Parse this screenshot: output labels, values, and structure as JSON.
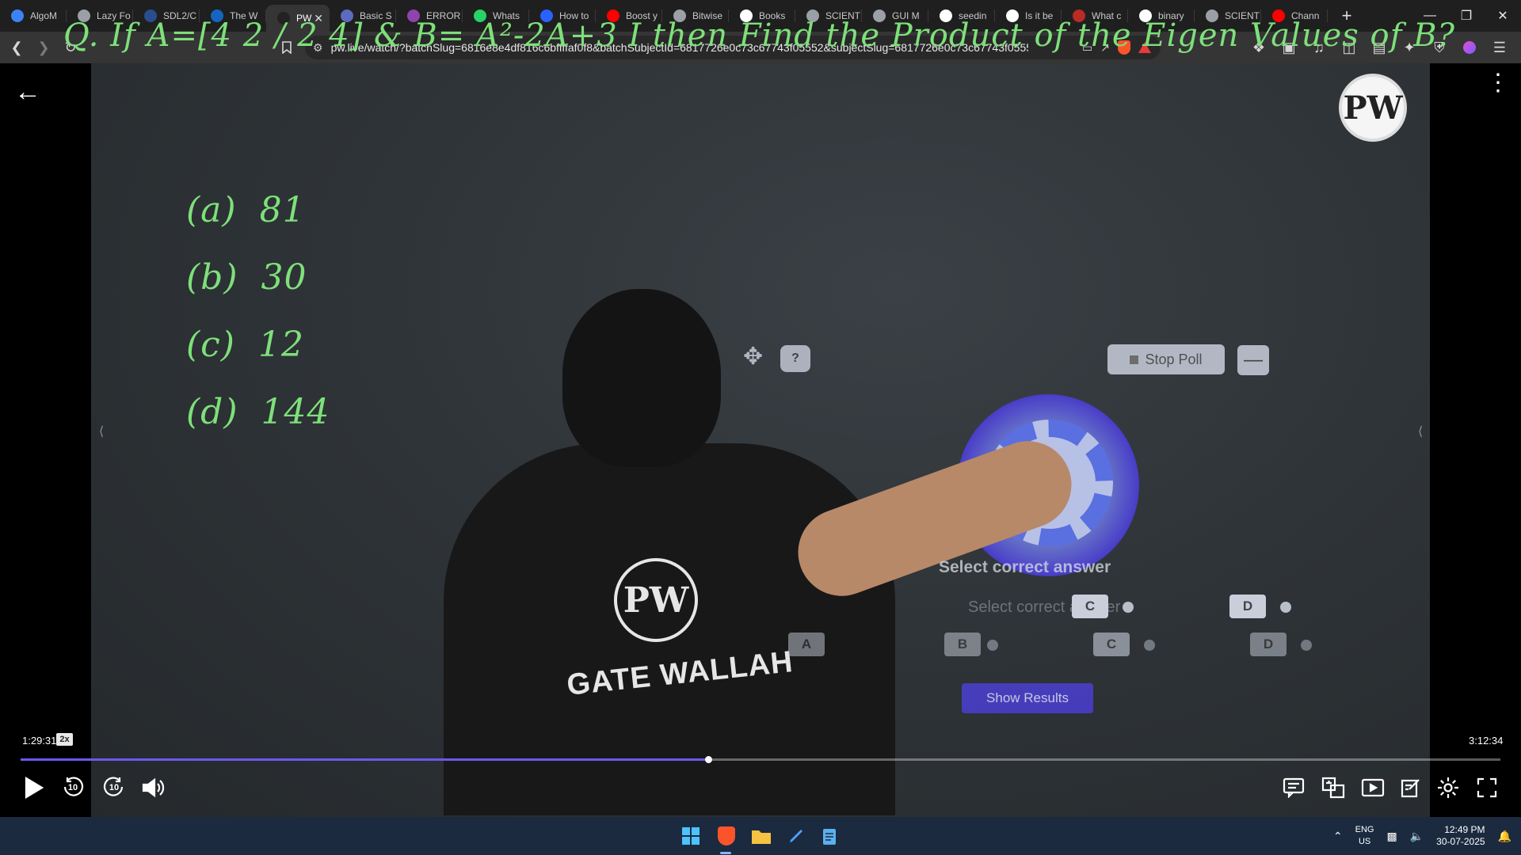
{
  "browser": {
    "tabs": [
      {
        "label": "AlgoM",
        "icon": "globe-icon",
        "color": "#3b82f6",
        "active": false
      },
      {
        "label": "Lazy Fo",
        "icon": "globe-icon",
        "color": "#9aa0a6",
        "active": false
      },
      {
        "label": "SDL2/C",
        "icon": "sdl-icon",
        "color": "#2a4d8f",
        "active": false
      },
      {
        "label": "The W",
        "icon": "ws-icon",
        "color": "#1565c0",
        "active": false
      },
      {
        "label": "PW",
        "icon": "pw-icon",
        "color": "#222222",
        "active": true
      },
      {
        "label": "Basic S",
        "icon": "page-icon",
        "color": "#5c6bc0",
        "active": false
      },
      {
        "label": "ERROR",
        "icon": "error-icon",
        "color": "#8e44ad",
        "active": false
      },
      {
        "label": "Whats",
        "icon": "whatsapp-icon",
        "color": "#25d366",
        "active": false
      },
      {
        "label": "How to",
        "icon": "page-icon",
        "color": "#2962ff",
        "active": false
      },
      {
        "label": "Boost y",
        "icon": "youtube-icon",
        "color": "#ff0000",
        "active": false
      },
      {
        "label": "Bitwise",
        "icon": "page-icon",
        "color": "#9aa0a6",
        "active": false
      },
      {
        "label": "Books",
        "icon": "google-icon",
        "color": "#ffffff",
        "active": false
      },
      {
        "label": "SCIENT",
        "icon": "globe-icon",
        "color": "#9aa0a6",
        "active": false
      },
      {
        "label": "GUI M",
        "icon": "openai-icon",
        "color": "#9aa0a6",
        "active": false
      },
      {
        "label": "seedin",
        "icon": "google-icon",
        "color": "#ffffff",
        "active": false
      },
      {
        "label": "Is it be",
        "icon": "google-icon",
        "color": "#ffffff",
        "active": false
      },
      {
        "label": "What c",
        "icon": "quora-icon",
        "color": "#b92b27",
        "active": false
      },
      {
        "label": "binary",
        "icon": "google-icon",
        "color": "#ffffff",
        "active": false
      },
      {
        "label": "SCIENT",
        "icon": "globe-icon",
        "color": "#9aa0a6",
        "active": false
      },
      {
        "label": "Chann",
        "icon": "youtube-icon",
        "color": "#ff0000",
        "active": false
      }
    ],
    "url": "pw.live/watch/?batchSlug=6816e8e4df816c6bffffaf0f8&batchSubjectId=6817726e0c73c67743f05552&subjectSlug=6817726e0c73c67743f05552..."
  },
  "video": {
    "board_question": "Q. If A=[4 2 / 2 4] & B= A²-2A+3 I then Find the Product of the Eigen Values of B?",
    "options": [
      {
        "label": "(a)",
        "value": "81"
      },
      {
        "label": "(b)",
        "value": "30"
      },
      {
        "label": "(c)",
        "value": "12"
      },
      {
        "label": "(d)",
        "value": "144"
      }
    ],
    "brand_logo": "PW",
    "shirt_text": "GATE WALLAH",
    "poll": {
      "stop_label": "Stop Poll",
      "minimize_label": "—",
      "help_label": "?",
      "prompt": "Select correct answer",
      "prompt_ghost": "Select correct answer",
      "options_row1": [
        "C",
        "D"
      ],
      "options_row2": [
        "A",
        "B",
        "C",
        "D"
      ],
      "show_results_label": "Show Results"
    },
    "time_current": "1:29:31",
    "speed": "2x",
    "time_total": "3:12:34",
    "progress_fraction": 0.4648,
    "seek_back_seconds": "10",
    "seek_forward_seconds": "10",
    "accent": "#6b58ee"
  },
  "taskbar": {
    "language": "ENG",
    "region": "US",
    "time": "12:49 PM",
    "date": "30-07-2025"
  }
}
